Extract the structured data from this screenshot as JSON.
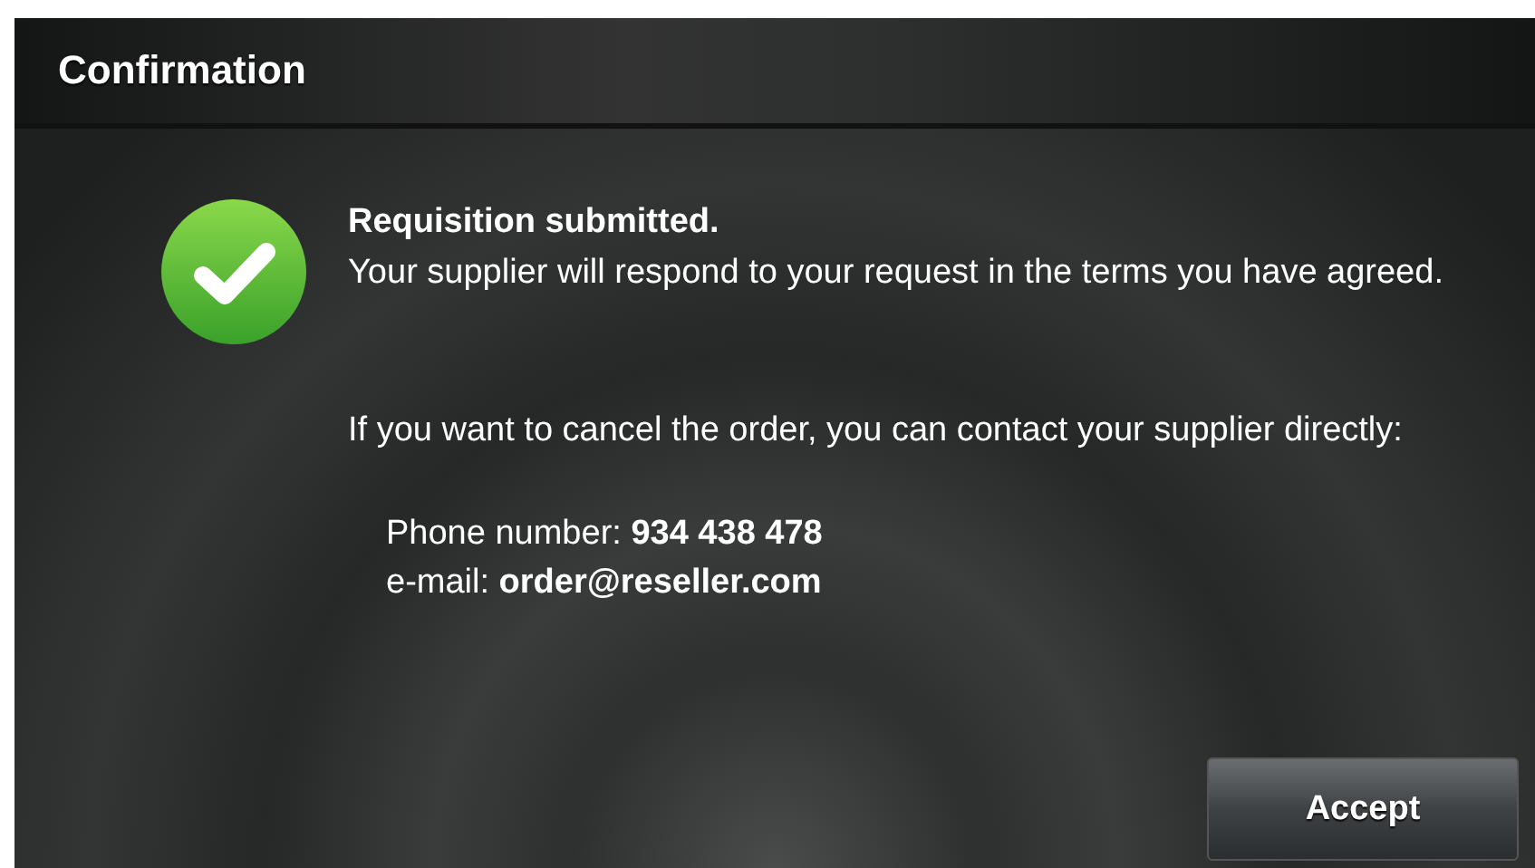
{
  "window": {
    "title": "Confirmation"
  },
  "message": {
    "heading": "Requisition submitted.",
    "body": "Your supplier will respond to your request in the terms you have agreed.",
    "note": "If you want to cancel the order, you can contact your supplier directly:"
  },
  "contact": [
    "Phone number: **934 438 478**",
    "e-mail: **order@reseller.com**"
  ],
  "buttons": [
    "Accept"
  ]
}
